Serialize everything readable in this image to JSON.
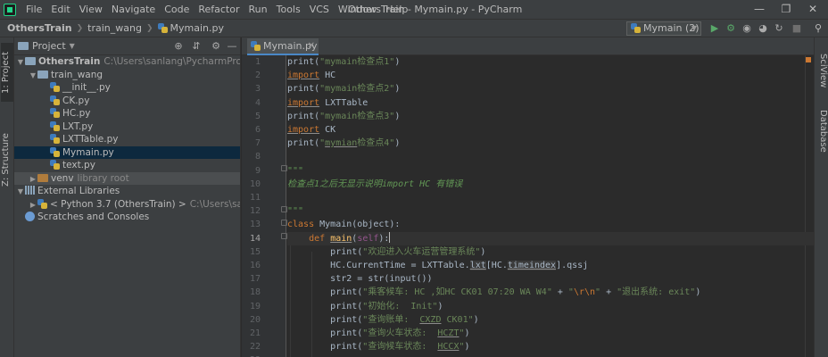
{
  "window": {
    "title": "OthersTrain - Mymain.py - PyCharm",
    "menu": [
      "File",
      "Edit",
      "View",
      "Navigate",
      "Code",
      "Refactor",
      "Run",
      "Tools",
      "VCS",
      "Window",
      "Help"
    ]
  },
  "navbar": {
    "breadcrumbs": [
      "OthersTrain",
      "train_wang",
      "Mymain.py"
    ],
    "run_config": "Mymain (2)"
  },
  "left_stripe": {
    "project_label": "1: Project",
    "structure_label": "Z: Structure"
  },
  "right_stripe": {
    "sciview_label": "SciView",
    "database_label": "Database"
  },
  "project_panel": {
    "title": "Project",
    "tree": [
      {
        "label": "OthersTrain",
        "hint": "C:\\Users\\sanlang\\PycharmProjects\\OthersTrain",
        "type": "folder",
        "level": 0,
        "expanded": true
      },
      {
        "label": "train_wang",
        "hint": "",
        "type": "folder",
        "level": 1,
        "expanded": true
      },
      {
        "label": "__init__.py",
        "hint": "",
        "type": "py",
        "level": 2
      },
      {
        "label": "CK.py",
        "hint": "",
        "type": "py",
        "level": 2
      },
      {
        "label": "HC.py",
        "hint": "",
        "type": "py",
        "level": 2
      },
      {
        "label": "LXT.py",
        "hint": "",
        "type": "py",
        "level": 2
      },
      {
        "label": "LXTTable.py",
        "hint": "",
        "type": "py",
        "level": 2
      },
      {
        "label": "Mymain.py",
        "hint": "",
        "type": "py",
        "level": 2,
        "selected": true
      },
      {
        "label": "text.py",
        "hint": "",
        "type": "py",
        "level": 2
      },
      {
        "label": "venv",
        "hint": "library root",
        "type": "folder-orange",
        "level": 1,
        "expanded": false,
        "active": true
      },
      {
        "label": "External Libraries",
        "hint": "",
        "type": "lib",
        "level": 0,
        "expanded": true
      },
      {
        "label": "< Python 3.7 (OthersTrain) >",
        "hint": "C:\\Users\\sanlang\\PycharmProjects\\OthersTrain",
        "type": "py",
        "level": 1,
        "expanded": false
      },
      {
        "label": "Scratches and Consoles",
        "hint": "",
        "type": "scratch",
        "level": 0
      }
    ]
  },
  "editor": {
    "tab_label": "Mymain.py",
    "current_line": "14",
    "line_numbers": [
      "1",
      "2",
      "3",
      "4",
      "5",
      "6",
      "7",
      "8",
      "9",
      "10",
      "11",
      "12",
      "13",
      "14",
      "15",
      "16",
      "17",
      "18",
      "19",
      "20",
      "21",
      "22",
      "23"
    ]
  },
  "code": {
    "l1": {
      "a": "print(",
      "b": "\"mymain检查点1\"",
      "c": ")"
    },
    "l2": {
      "kw": "import",
      "rest": " HC"
    },
    "l3": {
      "a": "print(",
      "b": "\"mymain检查点2\"",
      "c": ")"
    },
    "l4": {
      "kw": "import",
      "rest": " LXTTable"
    },
    "l5": {
      "a": "print(",
      "b": "\"mymain检查点3\"",
      "c": ")"
    },
    "l6": {
      "kw": "import",
      "rest": " CK"
    },
    "l7": {
      "a": "print(",
      "q": "\"",
      "u": "mymian",
      "b": "检查点4\"",
      "c": ")"
    },
    "l9": "\"\"\"",
    "l10": "检查点1之后无显示说明import HC 有错误",
    "l12": "\"\"\"",
    "l13": {
      "kw": "class",
      "rest": " Mymain(object):"
    },
    "l14": {
      "kw": "def",
      "fn": "main",
      "a": "(",
      "slf": "self",
      "b": "):"
    },
    "l15": {
      "a": "print(",
      "b": "\"欢迎进入火车运营管理系统\"",
      "c": ")"
    },
    "l16": {
      "a": "HC.CurrentTime = LXTTable.",
      "lxt": "lxt",
      "b": "[HC.",
      "ti": "timeindex",
      "c": "].qssj"
    },
    "l17": {
      "a": "str2 = str(input())"
    },
    "l18": {
      "a": "print(",
      "s1": "\"乘客候车: HC ,如HC CK01 07:20 WA W4\"",
      "p1": " + ",
      "q1": "\"",
      "esc": "\\r\\n",
      "q2": "\"",
      "p2": " + ",
      "s2": "\"退出系统: exit\"",
      "c": ")"
    },
    "l19": {
      "a": "print(",
      "b": "\"初始化:  Init\"",
      "c": ")"
    },
    "l20": {
      "a": "print(",
      "s1": "\"查询账单:  ",
      "u": "CXZD",
      "s2": " CK01\"",
      "c": ")"
    },
    "l21": {
      "a": "print(",
      "s1": "\"查询火车状态:  ",
      "u": "HCZT",
      "s2": "\"",
      "c": ")"
    },
    "l22": {
      "a": "print(",
      "s1": "\"查询候车状态:  ",
      "u": "HCCX",
      "s2": "\"",
      "c": ")"
    }
  }
}
